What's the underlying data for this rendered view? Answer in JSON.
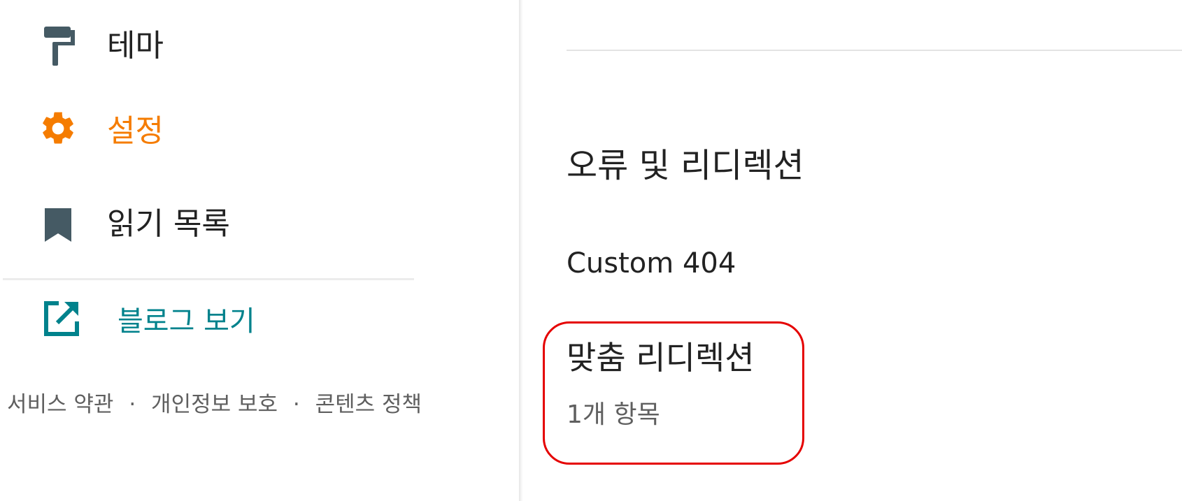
{
  "sidebar": {
    "items": [
      {
        "label": "테마",
        "icon": "paint-roller-icon",
        "active": false
      },
      {
        "label": "설정",
        "icon": "gear-icon",
        "active": true
      },
      {
        "label": "읽기 목록",
        "icon": "bookmark-icon",
        "active": false
      }
    ],
    "view_blog": {
      "label": "블로그 보기",
      "icon": "open-in-new-icon"
    },
    "footer": {
      "terms": "서비스 약관",
      "privacy": "개인정보 보호",
      "content_policy": "콘텐츠 정책",
      "separator": "·"
    }
  },
  "main": {
    "section_title": "오류 및 리디렉션",
    "custom_404": "Custom 404",
    "custom_redirects": {
      "title": "맞춤 리디렉션",
      "count": "1개 항목"
    }
  },
  "colors": {
    "accent": "#f57c00",
    "icon_default": "#455a64",
    "link": "#00828c",
    "highlight_box": "#e50000"
  }
}
